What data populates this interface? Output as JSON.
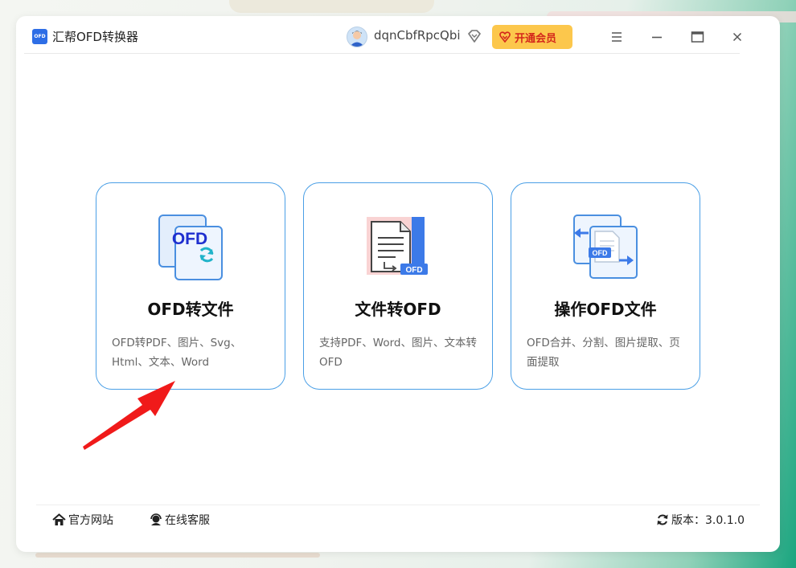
{
  "app": {
    "title": "汇帮OFD转换器",
    "logo_text": "OFD"
  },
  "user": {
    "name": "dqnCbfRpcQbi"
  },
  "header": {
    "vip_label": "开通会员"
  },
  "features": [
    {
      "title": "OFD转文件",
      "desc": "OFD转PDF、图片、Svg、Html、文本、Word",
      "icon": "ofd-convert-icon",
      "badge": "OFD"
    },
    {
      "title": "文件转OFD",
      "desc": "支持PDF、Word、图片、文本转OFD",
      "icon": "file-to-ofd-icon",
      "badge": "OFD"
    },
    {
      "title": "操作OFD文件",
      "desc": "OFD合并、分割、图片提取、页面提取",
      "icon": "ofd-operate-icon",
      "badge": "OFD"
    }
  ],
  "footer": {
    "website_label": "官方网站",
    "support_label": "在线客服",
    "version_label": "版本：3.0.1.0"
  },
  "colors": {
    "accent": "#4a9fe6",
    "vip": "#fcc74c",
    "vip_text": "#d4271b",
    "arrow": "#f01a1a"
  }
}
